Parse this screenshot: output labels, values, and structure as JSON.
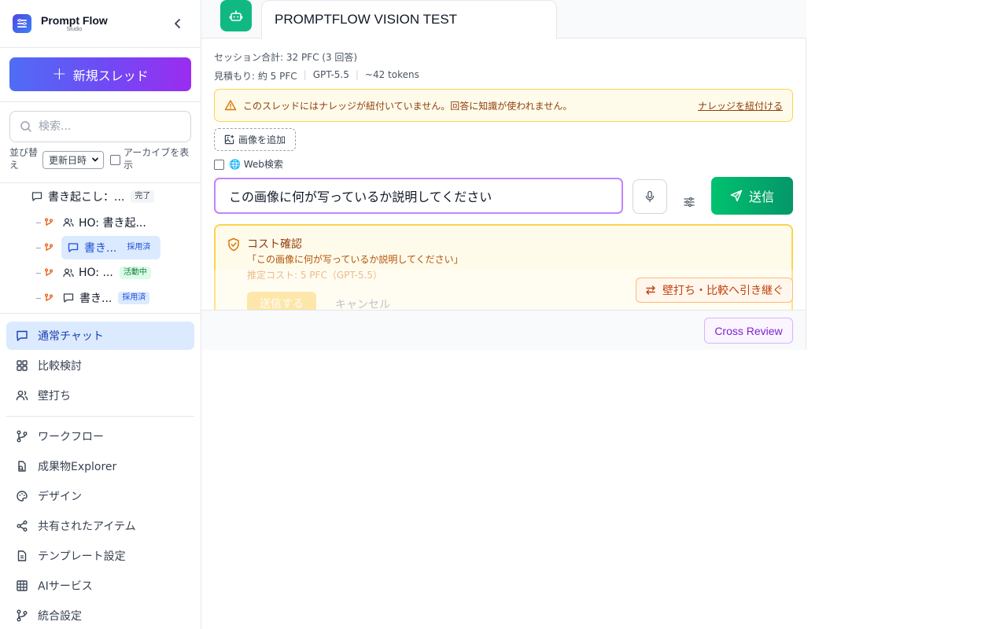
{
  "brand": {
    "name": "Prompt Flow",
    "sub": "Studio"
  },
  "sidebar": {
    "new_thread_label": "新規スレッド",
    "search_placeholder": "検索...",
    "sort_label": "並び替え",
    "sort_value": "更新日時",
    "archive_label": "アーカイブを表示",
    "tree": [
      {
        "label": "書き起こし：...",
        "badge": "完了"
      },
      {
        "label": "HO: 書き起...",
        "badge": ""
      },
      {
        "label": "書き...",
        "badge": "採用済"
      },
      {
        "label": "HO: ...",
        "badge": "活動中"
      },
      {
        "label": "書き...",
        "badge": "採用済"
      }
    ],
    "nav_primary": [
      {
        "label": "通常チャット"
      },
      {
        "label": "比較検討"
      },
      {
        "label": "壁打ち"
      }
    ],
    "nav_secondary": [
      {
        "label": "ワークフロー"
      },
      {
        "label": "成果物Explorer"
      },
      {
        "label": "デザイン"
      },
      {
        "label": "共有されたアイテム"
      },
      {
        "label": "テンプレート設定"
      },
      {
        "label": "AIサービス"
      },
      {
        "label": "統合設定"
      }
    ]
  },
  "main": {
    "title": "PROMPTFLOW VISION TEST",
    "session_total": "セッション合計: 32 PFC (3 回答)",
    "estimate": {
      "cost": "見積もり: 約 5 PFC",
      "model": "GPT-5.5",
      "tokens": "~42 tokens"
    },
    "warning": {
      "text": "このスレッドにはナレッジが紐付いていません。回答に知識が使われません。",
      "link": "ナレッジを紐付ける"
    },
    "add_image_label": "画像を追加",
    "web_search_label": "🌐 Web検索",
    "prompt_value": "この画像に何が写っているか説明してください",
    "send_label": "送信",
    "cost_confirm": {
      "title": "コスト確認",
      "quote": "「この画像に何が写っているか説明してください」",
      "estimate": "推定コスト: 5 PFC（GPT-5.5）",
      "ok_label": "送信する",
      "cancel_label": "キャンセル"
    },
    "handoff_label": "壁打ち・比較へ引き継ぐ",
    "cross_review_label": "Cross Review"
  },
  "colors": {
    "accent_blue": "#1e40af",
    "send_green": "#00c26f",
    "warning_bg": "#fffbeb",
    "cross_review_purple": "#7e22ce"
  }
}
